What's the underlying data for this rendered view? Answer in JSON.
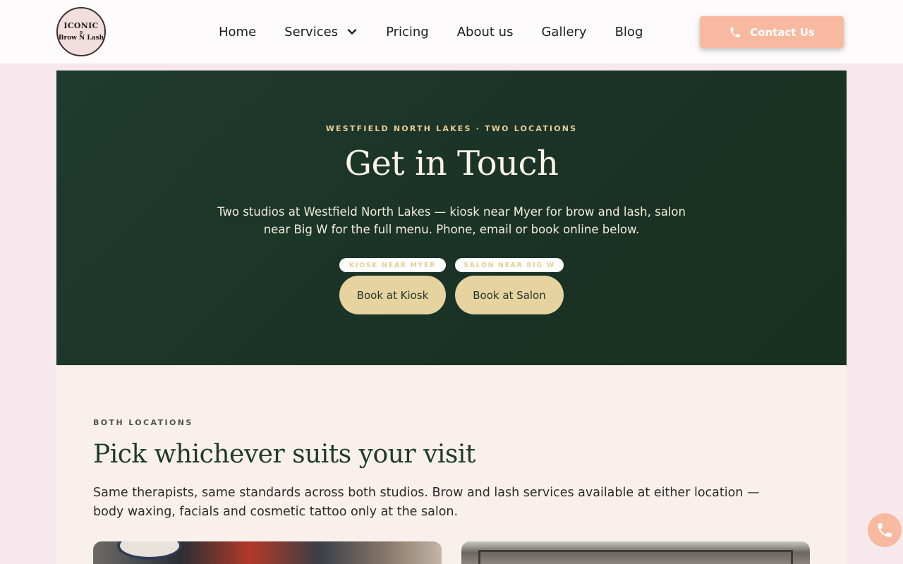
{
  "logo": {
    "line1": "ICONIC",
    "line2": "Brow N Lash"
  },
  "nav": {
    "items": [
      {
        "label": "Home"
      },
      {
        "label": "Services",
        "has_dropdown": true,
        "icon": "chevron-down-icon"
      },
      {
        "label": "Pricing"
      },
      {
        "label": "About us"
      },
      {
        "label": "Gallery"
      },
      {
        "label": "Blog"
      }
    ],
    "contact_label": "Contact Us",
    "contact_icon": "phone-icon"
  },
  "hero": {
    "eyebrow": "WESTFIELD NORTH LAKES · TWO LOCATIONS",
    "title": "Get in Touch",
    "subtitle": "Two studios at Westfield North Lakes — kiosk near Myer for brow and lash, salon near Big W for the full menu. Phone, email or book online below.",
    "locations": [
      {
        "tag": "KIOSK NEAR MYER",
        "button": "Book at Kiosk"
      },
      {
        "tag": "SALON NEAR BIG W",
        "button": "Book at Salon"
      }
    ]
  },
  "section": {
    "eyebrow": "BOTH LOCATIONS",
    "title": "Pick whichever suits your visit",
    "body": "Same therapists, same standards across both studios. Brow and lash services available at either location — body waxing, facials and cosmetic tattoo only at the salon."
  },
  "floating_call_icon": "phone-icon",
  "colors": {
    "accent": "#f7b9a0",
    "hero_bg": "#1f3a2e",
    "gold": "#e7d39f",
    "page_bg": "#f6e8ec",
    "section_bg": "#faf0eb"
  }
}
